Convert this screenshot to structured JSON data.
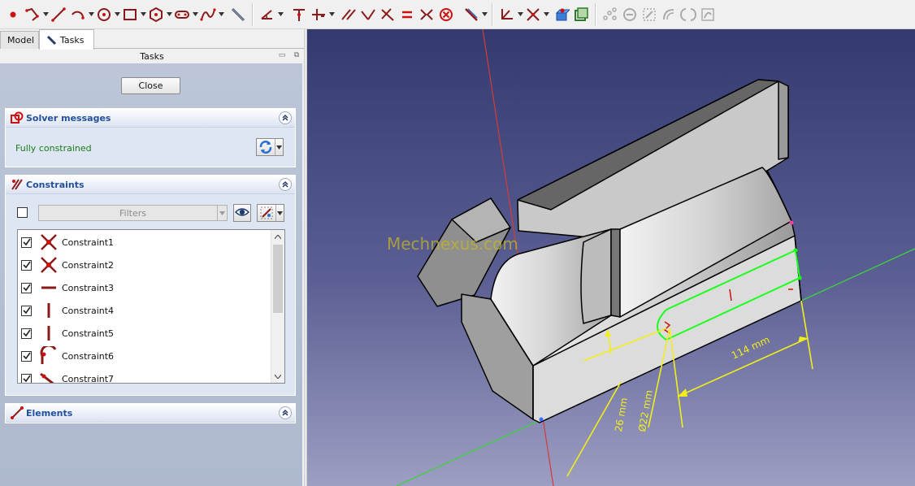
{
  "toolbar": {
    "groups": [
      [
        "point-icon",
        "polyline-icon",
        "line-icon",
        "arc-icon",
        "circle-icon",
        "rectangle-icon",
        "polygon-icon",
        "slot-icon",
        "bspline-icon",
        "external-geometry-icon"
      ],
      [
        "dimension-icon",
        "coincident-icon",
        "point-on-object-icon",
        "parallel-icon",
        "perpendicular-icon",
        "tangent-icon",
        "equal-icon",
        "symmetric-icon",
        "block-icon",
        "constrain-lock-icon"
      ],
      [
        "trim-icon",
        "extend-icon",
        "toggle-construction-icon",
        "clone-icon"
      ]
    ]
  },
  "panel": {
    "tabs": [
      "Model",
      "Tasks"
    ],
    "title": "Tasks",
    "close_label": "Close"
  },
  "solver": {
    "title": "Solver messages",
    "status": "Fully constrained"
  },
  "constraints": {
    "title": "Constraints",
    "filter_placeholder": "Filters",
    "items": [
      {
        "label": "Constraint1",
        "icon": "symmetric-cross-icon"
      },
      {
        "label": "Constraint2",
        "icon": "symmetric-cross-icon"
      },
      {
        "label": "Constraint3",
        "icon": "horizontal-icon"
      },
      {
        "label": "Constraint4",
        "icon": "vertical-icon"
      },
      {
        "label": "Constraint5",
        "icon": "vertical-icon"
      },
      {
        "label": "Constraint6",
        "icon": "tangent-arc-icon"
      },
      {
        "label": "Constraint7",
        "icon": "coincident-line-icon"
      }
    ]
  },
  "elements": {
    "title": "Elements"
  },
  "viewport": {
    "watermark": "Mechnexus.com",
    "dim_labels": [
      "114 mm",
      "26 mm",
      "Ø22 mm"
    ]
  },
  "colors": {
    "accent": "#21509d",
    "constraint_red": "#8b1a1a",
    "status_green": "#1a7a1a",
    "dimension_yellow": "#f2ee1a",
    "sketch_green": "#1aff1a"
  }
}
